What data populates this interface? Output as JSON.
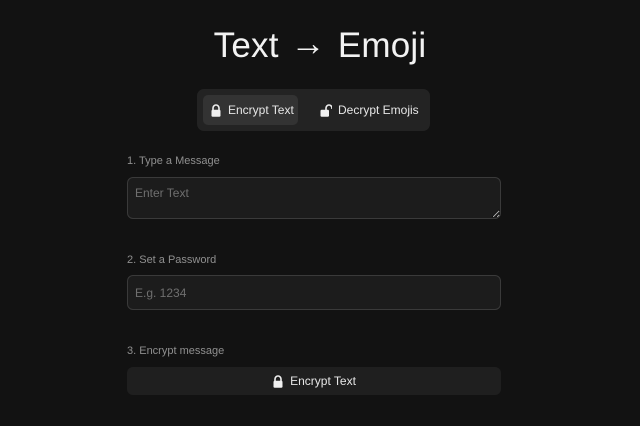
{
  "header": {
    "title_left": "Text",
    "title_arrow": "→",
    "title_right": "Emoji"
  },
  "mode_switch": {
    "encrypt_label": "Encrypt Text",
    "decrypt_label": "Decrypt Emojis",
    "active": "encrypt"
  },
  "form": {
    "message_label": "1. Type a Message",
    "message_placeholder": "Enter Text",
    "message_value": "",
    "password_label": "2. Set a Password",
    "password_placeholder": "E.g. 1234",
    "password_value": "",
    "encrypt_label": "3. Encrypt message",
    "submit_label": "Encrypt Text"
  },
  "icons": {
    "encrypt_tab": "lock-icon",
    "decrypt_tab": "unlock-icon",
    "submit": "lock-icon"
  },
  "colors": {
    "background": "#121212",
    "active_tab": "#333333",
    "text": "#e8e8e8"
  }
}
